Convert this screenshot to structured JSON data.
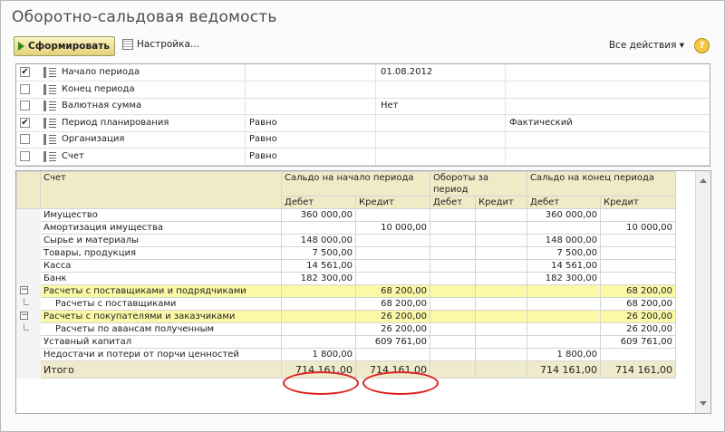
{
  "title": "Оборотно-сальдовая ведомость",
  "toolbar": {
    "generate_label": "Сформировать",
    "settings_label": "Настройка...",
    "actions_label": "Все действия ▾",
    "help_label": "?"
  },
  "filters": [
    {
      "checked": true,
      "name": "Начало периода",
      "comparison": "",
      "value": "01.08.2012",
      "value2": ""
    },
    {
      "checked": false,
      "name": "Конец периода",
      "comparison": "",
      "value": "",
      "value2": ""
    },
    {
      "checked": false,
      "name": "Валютная сумма",
      "comparison": "",
      "value": "Нет",
      "value2": ""
    },
    {
      "checked": true,
      "name": "Период планирования",
      "comparison": "Равно",
      "value": "",
      "value2": "Фактический"
    },
    {
      "checked": false,
      "name": "Организация",
      "comparison": "Равно",
      "value": "",
      "value2": ""
    },
    {
      "checked": false,
      "name": "Счет",
      "comparison": "Равно",
      "value": "",
      "value2": ""
    }
  ],
  "report": {
    "headers": {
      "account": "Счет",
      "opening": "Сальдо на начало периода",
      "turnover": "Обороты за период",
      "closing": "Сальдо на конец периода",
      "debit": "Дебет",
      "credit": "Кредит"
    },
    "rows": [
      {
        "account": "Имущество",
        "od": "360 000,00",
        "oc": "",
        "td": "",
        "tc": "",
        "cd": "360 000,00",
        "cc": "",
        "type": "normal"
      },
      {
        "account": "Амортизация имущества",
        "od": "",
        "oc": "10 000,00",
        "td": "",
        "tc": "",
        "cd": "",
        "cc": "10 000,00",
        "type": "normal"
      },
      {
        "account": "Сырье и материалы",
        "od": "148 000,00",
        "oc": "",
        "td": "",
        "tc": "",
        "cd": "148 000,00",
        "cc": "",
        "type": "normal"
      },
      {
        "account": "Товары, продукция",
        "od": "7 500,00",
        "oc": "",
        "td": "",
        "tc": "",
        "cd": "7 500,00",
        "cc": "",
        "type": "normal"
      },
      {
        "account": "Касса",
        "od": "14 561,00",
        "oc": "",
        "td": "",
        "tc": "",
        "cd": "14 561,00",
        "cc": "",
        "type": "normal"
      },
      {
        "account": "Банк",
        "od": "182 300,00",
        "oc": "",
        "td": "",
        "tc": "",
        "cd": "182 300,00",
        "cc": "",
        "type": "normal"
      },
      {
        "account": "Расчеты с поставщиками и подрядчиками",
        "od": "",
        "oc": "68 200,00",
        "td": "",
        "tc": "",
        "cd": "",
        "cc": "68 200,00",
        "type": "group"
      },
      {
        "account": "Расчеты с поставщиками",
        "od": "",
        "oc": "68 200,00",
        "td": "",
        "tc": "",
        "cd": "",
        "cc": "68 200,00",
        "type": "child-last"
      },
      {
        "account": "Расчеты с покупателями и заказчиками",
        "od": "",
        "oc": "26 200,00",
        "td": "",
        "tc": "",
        "cd": "",
        "cc": "26 200,00",
        "type": "group"
      },
      {
        "account": "Расчеты по авансам полученным",
        "od": "",
        "oc": "26 200,00",
        "td": "",
        "tc": "",
        "cd": "",
        "cc": "26 200,00",
        "type": "child-last"
      },
      {
        "account": "Уставный капитал",
        "od": "",
        "oc": "609 761,00",
        "td": "",
        "tc": "",
        "cd": "",
        "cc": "609 761,00",
        "type": "normal"
      },
      {
        "account": "Недостачи и потери от порчи ценностей",
        "od": "1 800,00",
        "oc": "",
        "td": "",
        "tc": "",
        "cd": "1 800,00",
        "cc": "",
        "type": "normal"
      }
    ],
    "total": {
      "account": "Итого",
      "od": "714 161,00",
      "oc": "714 161,00",
      "td": "",
      "tc": "",
      "cd": "714 161,00",
      "cc": "714 161,00"
    },
    "highlight_color": "#fcf9a6",
    "annotation_color": "#dd2222"
  }
}
